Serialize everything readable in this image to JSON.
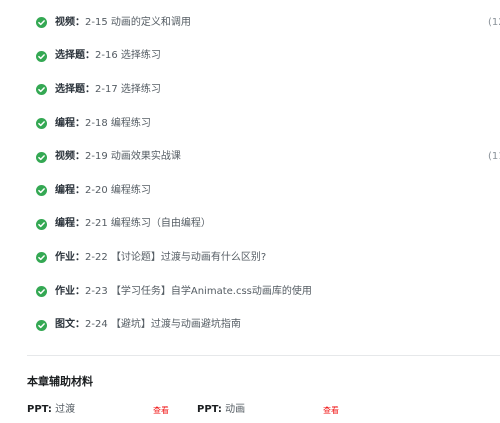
{
  "chapter_items": [
    {
      "type": "视频：",
      "title": "2-15 动画的定义和调用",
      "duration": "(12"
    },
    {
      "type": "选择题：",
      "title": "2-16 选择练习",
      "duration": ""
    },
    {
      "type": "选择题：",
      "title": "2-17 选择练习",
      "duration": ""
    },
    {
      "type": "编程：",
      "title": "2-18 编程练习",
      "duration": ""
    },
    {
      "type": "视频：",
      "title": "2-19 动画效果实战课",
      "duration": "(11"
    },
    {
      "type": "编程：",
      "title": "2-20 编程练习",
      "duration": ""
    },
    {
      "type": "编程：",
      "title": "2-21 编程练习（自由编程）",
      "duration": ""
    },
    {
      "type": "作业：",
      "title": "2-22 【讨论题】过渡与动画有什么区别?",
      "duration": ""
    },
    {
      "type": "作业：",
      "title": "2-23 【学习任务】自学Animate.css动画库的使用",
      "duration": ""
    },
    {
      "type": "图文：",
      "title": "2-24 【避坑】过渡与动画避坑指南",
      "duration": ""
    }
  ],
  "auxiliary": {
    "title": "本章辅助材料",
    "materials": [
      {
        "type": "PPT:",
        "name": " 过渡",
        "link": "查看"
      },
      {
        "type": "PPT:",
        "name": " 动画",
        "link": "查看"
      }
    ]
  },
  "colors": {
    "check": "#34a853",
    "link": "#f01414"
  },
  "icons": {
    "item_status": "check-circle-icon"
  }
}
